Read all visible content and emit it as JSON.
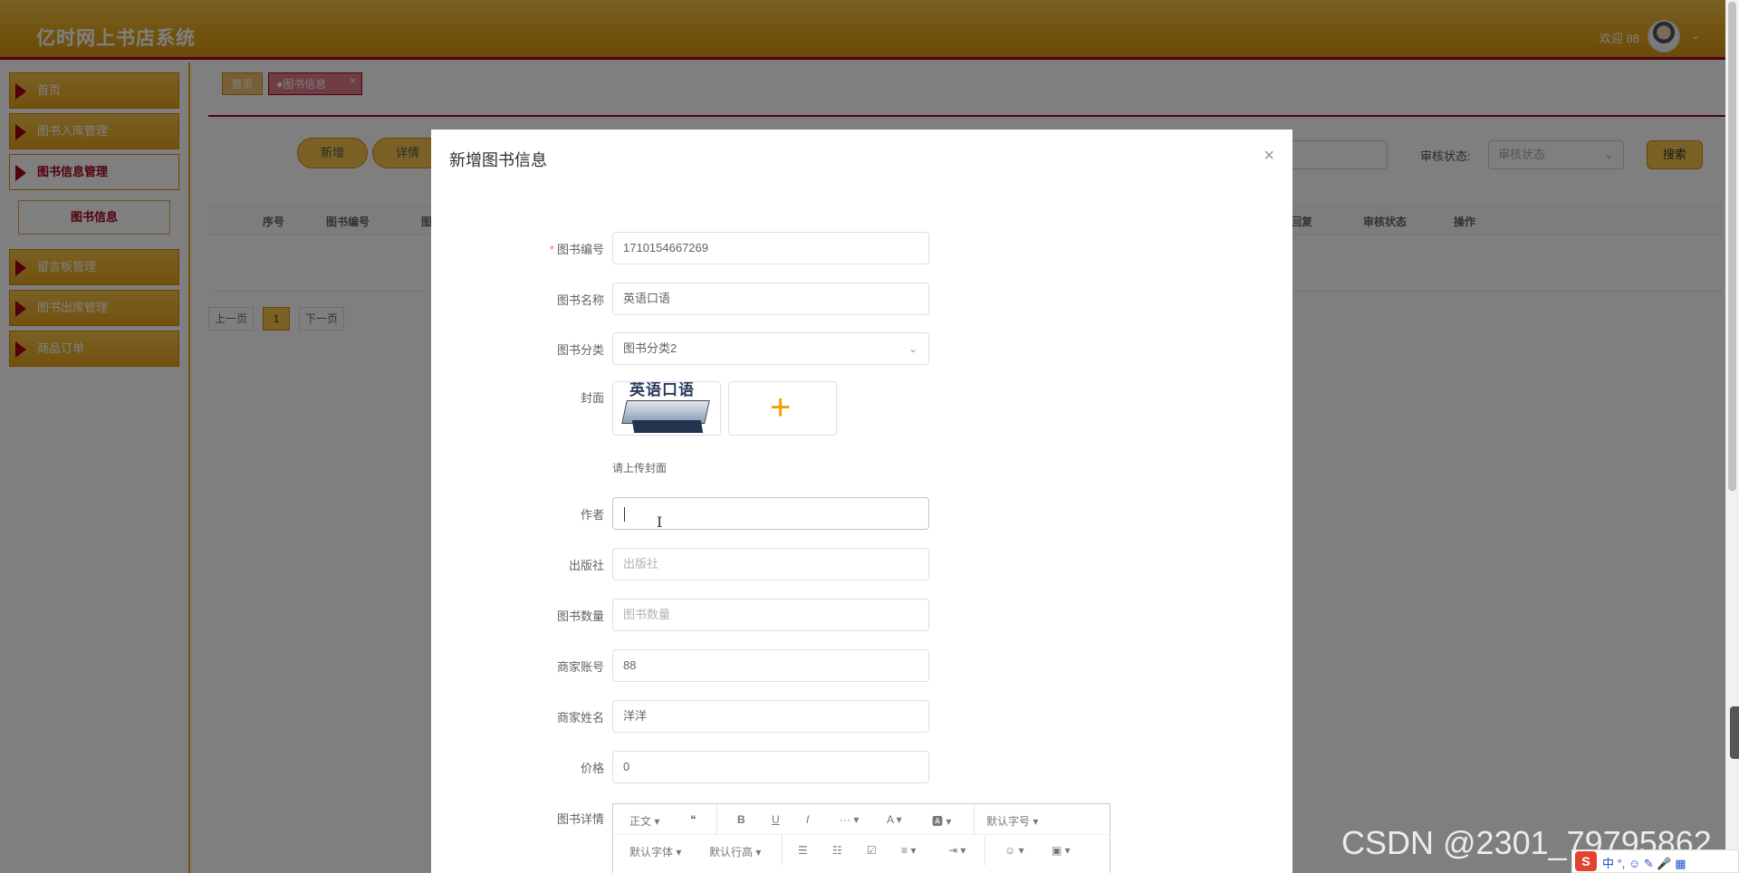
{
  "header": {
    "brand": "亿时网上书店系统",
    "welcome": "欢迎 88",
    "chevron": "⌄"
  },
  "sidebar": {
    "items": [
      {
        "label": "首页"
      },
      {
        "label": "图书入库管理"
      },
      {
        "label": "图书信息管理"
      },
      {
        "label": "留言板管理"
      },
      {
        "label": "图书出库管理"
      },
      {
        "label": "商品订单"
      }
    ],
    "sub_item": "图书信息"
  },
  "tabs": {
    "home": "首页",
    "book": "●图书信息",
    "close": "×"
  },
  "toolbar": {
    "add": "新增",
    "detail": "详情",
    "audit_label": "审核状态:",
    "audit_placeholder": "审核状态",
    "search": "搜索"
  },
  "table": {
    "columns": [
      "序号",
      "图书编号",
      "图",
      "回复",
      "审核状态",
      "操作"
    ]
  },
  "pager": {
    "prev": "上一页",
    "current": "1",
    "next": "下一页"
  },
  "dialog": {
    "title": "新增图书信息",
    "close": "×",
    "fields": {
      "book_no": {
        "label": "图书编号",
        "value": "1710154667269",
        "required": true
      },
      "book_name": {
        "label": "图书名称",
        "value": "英语口语"
      },
      "category": {
        "label": "图书分类",
        "value": "图书分类2"
      },
      "cover": {
        "label": "封面",
        "cover_text": "英语口语",
        "tip": "请上传封面"
      },
      "author": {
        "label": "作者",
        "value": "|"
      },
      "publisher": {
        "label": "出版社",
        "placeholder": "出版社"
      },
      "quantity": {
        "label": "图书数量",
        "placeholder": "图书数量"
      },
      "merchant_account": {
        "label": "商家账号",
        "value": "88"
      },
      "merchant_name": {
        "label": "商家姓名",
        "value": "洋洋"
      },
      "price": {
        "label": "价格",
        "value": "0"
      },
      "detail": {
        "label": "图书详情"
      }
    },
    "editor_toolbar_row1": [
      "正文 ▾",
      "❝",
      "B",
      "U",
      "I",
      "··· ▾",
      "A ▾",
      "🅰 ▾",
      "默认字号 ▾"
    ],
    "editor_toolbar_row2": [
      "默认字体 ▾",
      "默认行高 ▾",
      "☰",
      "☷",
      "☑",
      "≡ ▾",
      "⇥ ▾",
      "☺ ▾",
      "▣ ▾"
    ]
  },
  "watermark": "CSDN @2301_79795862",
  "ime": {
    "logo": "S",
    "text": "中 °, ☺ ✎ 🎤 ▦"
  }
}
